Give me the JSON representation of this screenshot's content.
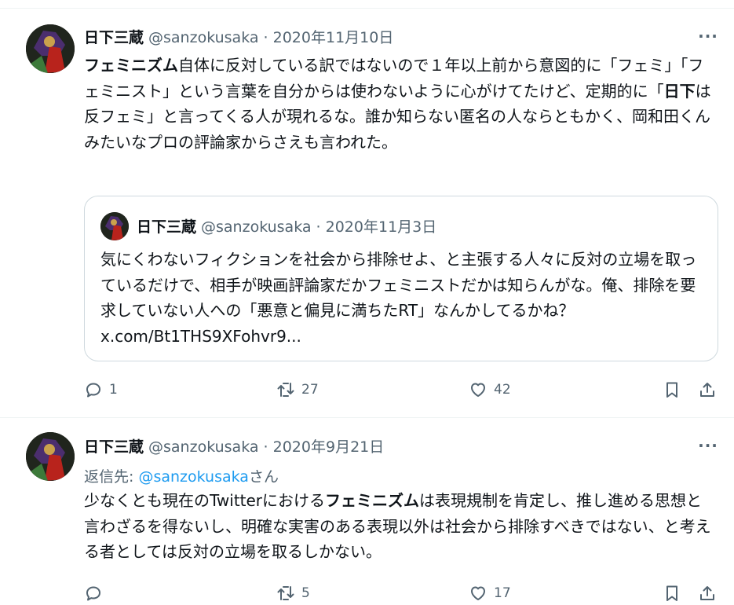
{
  "tweets": [
    {
      "name": "日下三蔵",
      "handle": "@sanzokusaka · 2020年11月10日",
      "body": {
        "b1": "フェミニズム",
        "t1": "自体に反対している訳ではないので１年以上前から意図的に「フェミ」「フェミニスト」という言葉を自分からは使わないように心がけてたけど、定期的に「",
        "b2": "日下",
        "t2": "は反フェミ」と言ってくる人が現れるな。誰か知らない匿名の人ならともかく、岡和田くんみたいなプロの評論家からさえも言われた。"
      },
      "quote": {
        "name": "日下三蔵",
        "handle": "@sanzokusaka · 2020年11月3日",
        "text": "気にくわないフィクションを社会から排除せよ、と主張する人々に反対の立場を取っているだけで、相手が映画評論家だかフェミニストだかは知らんがな。俺、排除を要求していない人への「悪意と偏見に満ちたRT」なんかしてるかね？ x.com/Bt1THS9XFohvr9..."
      },
      "actions": {
        "replies": "1",
        "retweets": "27",
        "likes": "42"
      }
    },
    {
      "name": "日下三蔵",
      "handle": "@sanzokusaka · 2020年9月21日",
      "reply_to": {
        "prefix": "返信先: ",
        "mention": "@sanzokusaka",
        "suffix": "さん"
      },
      "body": {
        "t1": "少なくとも現在のTwitterにおける",
        "b1": "フェミニズム",
        "t2": "は表現規制を肯定し、推し進める思想と言わざるを得ないし、明確な実害のある表現以外は社会から排除すべきではない、と考える者としては反対の立場を取るしかない。"
      },
      "actions": {
        "replies": "",
        "retweets": "5",
        "likes": "17"
      }
    }
  ],
  "colors": {
    "text": "#0f1419",
    "secondary": "#536471",
    "link": "#1d9bf0",
    "border": "#cfd9de"
  },
  "icons": [
    "more-icon",
    "reply-icon",
    "retweet-icon",
    "like-icon",
    "bookmark-icon",
    "share-icon"
  ]
}
